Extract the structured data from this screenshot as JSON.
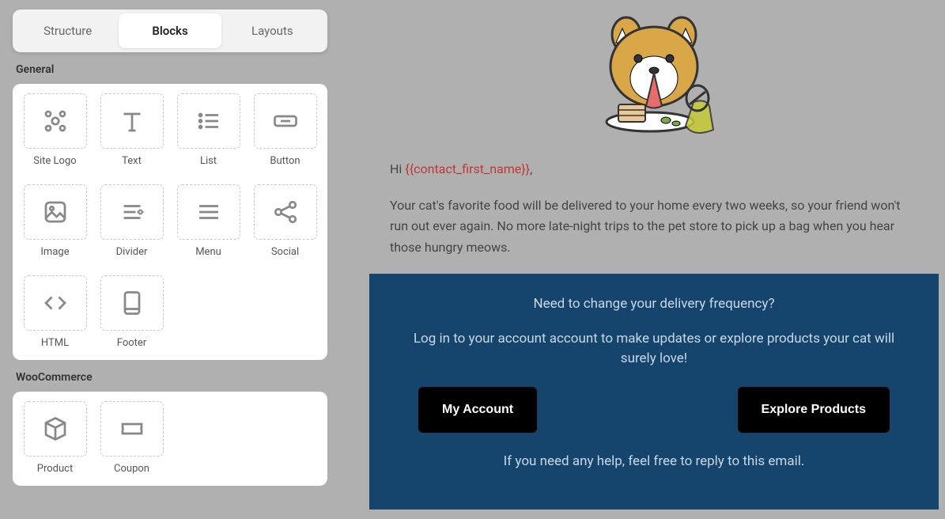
{
  "tabs": {
    "structure": "Structure",
    "blocks": "Blocks",
    "layouts": "Layouts"
  },
  "sections": {
    "general": {
      "title": "General",
      "blocks": [
        {
          "name": "site-logo",
          "label": "Site Logo"
        },
        {
          "name": "text",
          "label": "Text"
        },
        {
          "name": "list",
          "label": "List"
        },
        {
          "name": "button",
          "label": "Button"
        },
        {
          "name": "image",
          "label": "Image"
        },
        {
          "name": "divider",
          "label": "Divider"
        },
        {
          "name": "menu",
          "label": "Menu"
        },
        {
          "name": "social",
          "label": "Social"
        },
        {
          "name": "html",
          "label": "HTML"
        },
        {
          "name": "footer",
          "label": "Footer"
        }
      ]
    },
    "woo": {
      "title": "WooCommerce",
      "blocks": [
        {
          "name": "product",
          "label": "Product"
        },
        {
          "name": "coupon",
          "label": "Coupon"
        }
      ]
    }
  },
  "email": {
    "greeting_prefix": "Hi ",
    "greeting_var": "{{contact_first_name}}",
    "greeting_suffix": ",",
    "body": "Your cat's favorite food will be delivered to your home every two weeks, so your friend won't run out ever again. No more late-night trips to the pet store to pick up a bag when you hear those hungry meows.",
    "band_q": "Need to change your delivery frequency?",
    "band_p": "Log in to your account account to make updates or explore products your cat will surely love!",
    "cta_account": "My Account",
    "cta_explore": "Explore Products",
    "help": "If you need any help, feel free to reply to this email."
  }
}
